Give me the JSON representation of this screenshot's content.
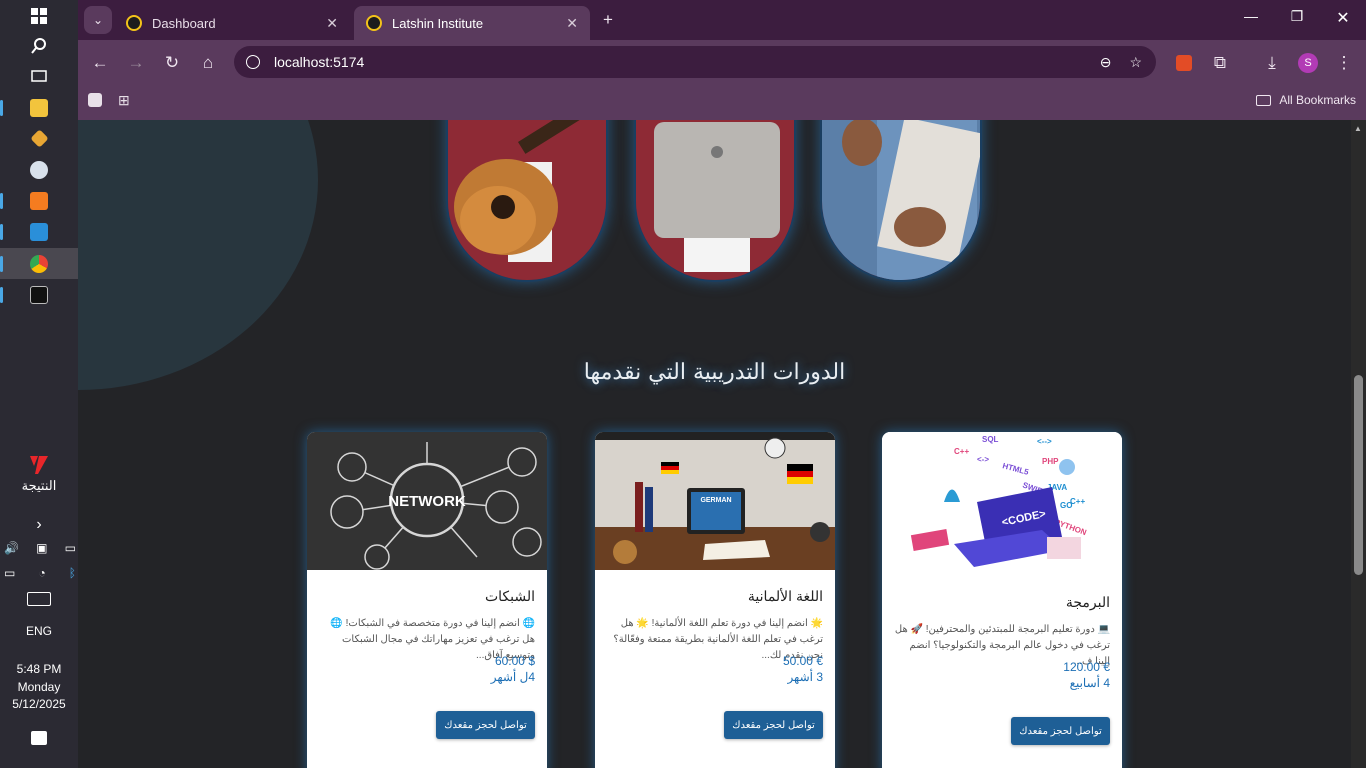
{
  "taskbar": {
    "brand_label": "النتيجة",
    "language": "ENG",
    "time": "5:48 PM",
    "day": "Monday",
    "date": "5/12/2025"
  },
  "browser": {
    "tabs": [
      {
        "label": "Dashboard",
        "active": false
      },
      {
        "label": "Latshin Institute",
        "active": true
      }
    ],
    "url": "localhost:5174",
    "bookmarks_label": "All Bookmarks",
    "profile_initial": "S"
  },
  "page": {
    "section_title": "الدورات التدريبية التي نقدمها",
    "courses": [
      {
        "title": "الشبكات",
        "description": "🌐 انضم إلينا في دورة متخصصة في الشبكات! 🌐 هل ترغب في تعزيز مهاراتك في مجال الشبكات وتوسيع آفاق...",
        "price": "60.00 $",
        "duration": "4ل أشهر",
        "button": "تواصل لحجز مقعدك",
        "image_text": "NETWORK"
      },
      {
        "title": "اللغة الألمانية",
        "description": "🌟 انضم إلينا في دورة تعلم اللغة الألمانية! 🌟 هل ترغب في تعلم اللغة الألمانية بطريقة ممتعة وفعّالة؟ نحن نقدم لك...",
        "price": "50.00 €",
        "duration": "3 أشهر",
        "button": "تواصل لحجز مقعدك",
        "image_text": "GERMAN"
      },
      {
        "title": "البرمجة",
        "description": "💻 دورة تعليم البرمجة للمبتدئين والمحترفين! 🚀 هل ترغب في دخول عالم البرمجة والتكنولوجيا؟ انضم إلينا ف...",
        "price": "120.00 €",
        "duration": "4 أسابيع",
        "button": "تواصل لحجز مقعدك",
        "image_text": "<CODE>"
      }
    ]
  },
  "colors": {
    "accent": "#1e5f96",
    "chrome": "#3c1d3f",
    "page_bg": "#232427"
  }
}
